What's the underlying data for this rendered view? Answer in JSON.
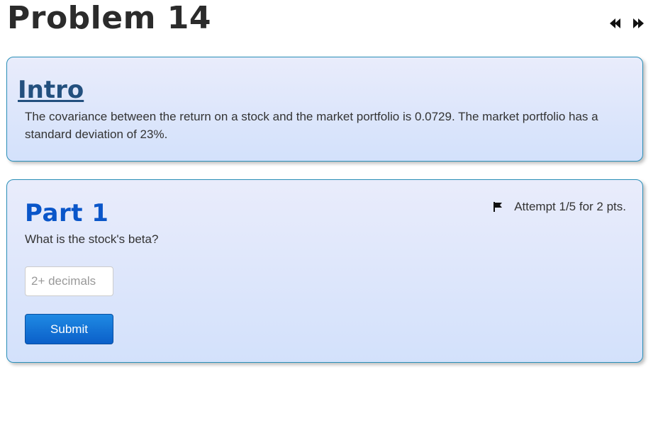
{
  "page": {
    "title": "Problem 14"
  },
  "nav": {
    "prev_icon": "rewind-icon",
    "next_icon": "fast-forward-icon"
  },
  "intro": {
    "heading": "Intro",
    "text": "The covariance between the return on a stock and the market portfolio is 0.0729. The market portfolio has a standard deviation of 23%."
  },
  "part1": {
    "heading": "Part 1",
    "attempt_text": "Attempt 1/5 for 2 pts.",
    "flag_icon": "flag-icon",
    "question": "What is the stock's beta?",
    "input_value": "",
    "input_placeholder": "2+ decimals",
    "submit_label": "Submit"
  },
  "colors": {
    "card_border": "#2a8fb8",
    "intro_heading": "#23507e",
    "part_heading": "#0a56c9",
    "submit_bg": "#0b5fc9"
  }
}
